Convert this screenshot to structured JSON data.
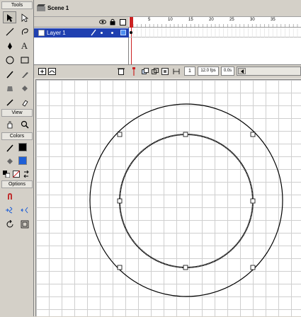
{
  "toolbox": {
    "title": "Tools",
    "view_label": "View",
    "colors_label": "Colors",
    "options_label": "Options"
  },
  "scene": {
    "name": "Scene 1"
  },
  "timeline": {
    "layer_name": "Layer 1",
    "ruler_numbers": [
      "5",
      "10",
      "15",
      "20",
      "25",
      "30",
      "35"
    ],
    "current_frame": "1",
    "fps": "12.0 fps",
    "time": "0.0s"
  },
  "colors": {
    "stroke": "#000000",
    "fill": "#1f5fd6",
    "accent": "#1f5fd6",
    "playhead": "#cc2222"
  }
}
